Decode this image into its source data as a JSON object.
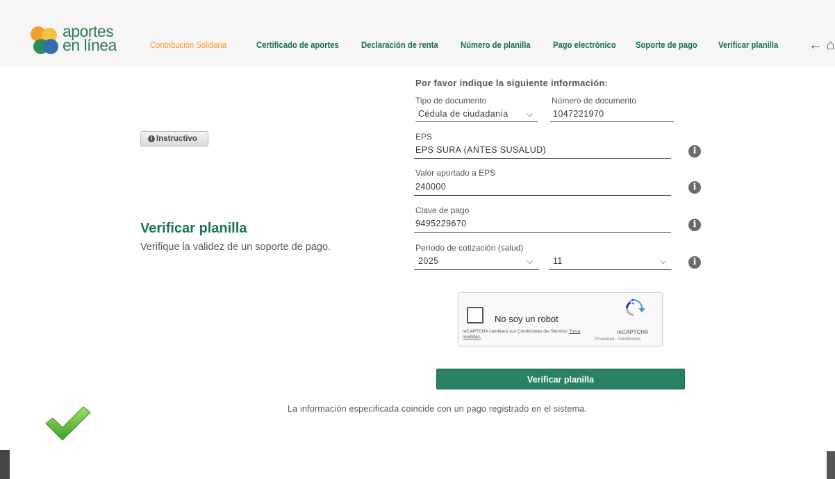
{
  "logo": {
    "line1": "aportes",
    "line2": "en línea"
  },
  "nav": {
    "items": [
      "Contribución Solidaria",
      "Certificado de aportes",
      "Declaración de renta",
      "Número de planilla",
      "Pago electrónico",
      "Soporte de pago",
      "Verificar planilla"
    ],
    "active_index": 0,
    "arrows": "← ⌂"
  },
  "instructivo_label": "Instructivo",
  "hero": {
    "title": "Verificar planilla",
    "subtitle": "Verifique la validez de un soporte de pago."
  },
  "form": {
    "prompt": "Por favor indique la siguiente información:",
    "doc_type_label": "Tipo de documento",
    "doc_type_value": "Cédula de ciudadanía",
    "doc_number_label": "Número de documento",
    "doc_number_value": "1047221970",
    "eps_label": "EPS",
    "eps_value": "EPS SURA (ANTES SUSALUD)",
    "valor_label": "Valor aportado a EPS",
    "valor_value": "240000",
    "clave_label": "Clave de pago",
    "clave_value": "9495229670",
    "periodo_label": "Período de cotización (salud)",
    "periodo_year": "2025",
    "periodo_month": "11"
  },
  "captcha": {
    "label": "No soy un robot",
    "notice": "reCAPTCHA cambiará sus Condiciones del Servicio.",
    "notice_link": "Toma medidas.",
    "brand": "reCAPTCHA",
    "terms": "Privacidad - Condiciones"
  },
  "submit_label": "Verificar planilla",
  "result_message": "La información especificada coincide con un pago registrado en el sistema.",
  "colors": {
    "brand_green": "#1f6f5c",
    "active_nav": "#f29a2e",
    "button": "#2a8063"
  }
}
